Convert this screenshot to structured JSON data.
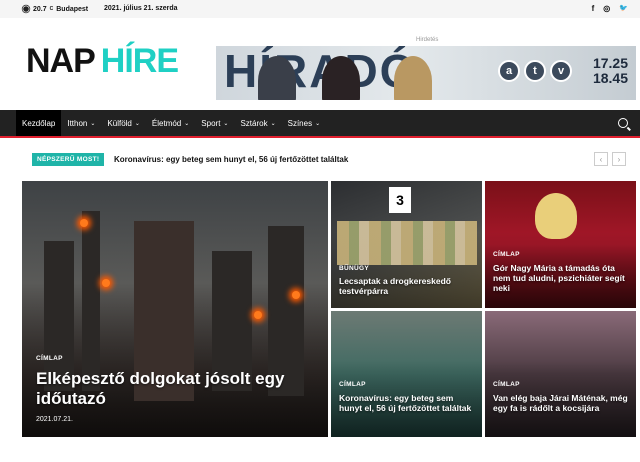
{
  "topbar": {
    "temperature": "20.7",
    "temp_unit": "C",
    "city": "Budapest",
    "date": "2021. július 21. szerda",
    "social": [
      "f",
      "◎",
      "🐦"
    ]
  },
  "logo": {
    "part1": "NAP",
    "part2": "HÍRE"
  },
  "ad": {
    "label": "Hirdetés",
    "title": "HÍRADÓ",
    "channel_letters": [
      "a",
      "t",
      "v"
    ],
    "time1": "17.25",
    "time2": "18.45"
  },
  "nav": {
    "items": [
      {
        "label": "Kezdőlap",
        "active": true,
        "has_dropdown": false
      },
      {
        "label": "Itthon",
        "active": false,
        "has_dropdown": true
      },
      {
        "label": "Külföld",
        "active": false,
        "has_dropdown": true
      },
      {
        "label": "Életmód",
        "active": false,
        "has_dropdown": true
      },
      {
        "label": "Sport",
        "active": false,
        "has_dropdown": true
      },
      {
        "label": "Sztárok",
        "active": false,
        "has_dropdown": true
      },
      {
        "label": "Színes",
        "active": false,
        "has_dropdown": true
      }
    ]
  },
  "ticker": {
    "label": "NÉPSZERŰ MOST!",
    "headline": "Koronavírus: egy beteg sem hunyt el, 56 új fertőzöttet találtak"
  },
  "articles": {
    "main": {
      "category": "CÍMLAP",
      "headline": "Elképesztő dolgokat jósolt egy időutazó",
      "date": "2021.07.21."
    },
    "a": {
      "category": "BŰNÜGY",
      "headline": "Lecsaptak a drogkereskedő testvérpárra",
      "tag": "3"
    },
    "b": {
      "category": "CÍMLAP",
      "headline": "Gór Nagy Mária a támadás óta nem tud aludni, pszichiáter segít neki"
    },
    "c": {
      "category": "CÍMLAP",
      "headline": "Koronavírus: egy beteg sem hunyt el, 56 új fertőzöttet találtak"
    },
    "d": {
      "category": "CÍMLAP",
      "headline": "Van elég baja Járai Máténak, még egy fa is rádőlt a kocsijára"
    }
  },
  "colors": {
    "accent_teal": "#1fd0c4",
    "nav_bg": "#222222",
    "nav_border": "#e01f2e",
    "ticker_label_bg": "#1fb4a8"
  }
}
